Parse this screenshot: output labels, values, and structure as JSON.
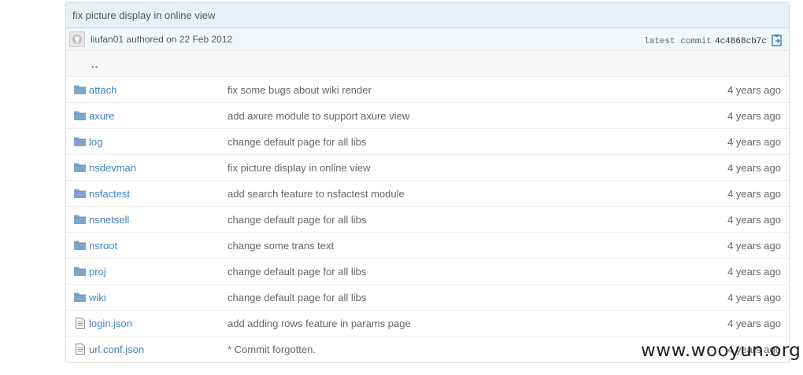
{
  "commit": {
    "title": "fix picture display in online view",
    "author": "liufan01",
    "authored_text": "authored on 22 Feb 2012",
    "latest_label": "latest commit",
    "sha": "4c4868cb7c"
  },
  "up_link": "..",
  "files": [
    {
      "name": "attach",
      "type": "folder",
      "message": "fix some bugs about wiki render",
      "age": "4 years ago"
    },
    {
      "name": "axure",
      "type": "folder",
      "message": "add axure module to support axure view",
      "age": "4 years ago"
    },
    {
      "name": "log",
      "type": "folder",
      "message": "change default page for all libs",
      "age": "4 years ago"
    },
    {
      "name": "nsdevman",
      "type": "folder",
      "message": "fix picture display in online view",
      "age": "4 years ago"
    },
    {
      "name": "nsfactest",
      "type": "folder",
      "message": "add search feature to nsfactest module",
      "age": "4 years ago"
    },
    {
      "name": "nsnetsell",
      "type": "folder",
      "message": "change default page for all libs",
      "age": "4 years ago"
    },
    {
      "name": "nsroot",
      "type": "folder",
      "message": "change some trans text",
      "age": "4 years ago"
    },
    {
      "name": "proj",
      "type": "folder",
      "message": "change default page for all libs",
      "age": "4 years ago"
    },
    {
      "name": "wiki",
      "type": "folder",
      "message": "change default page for all libs",
      "age": "4 years ago"
    },
    {
      "name": "login.json",
      "type": "file",
      "message": "add adding rows feature in params page",
      "age": "4 years ago"
    },
    {
      "name": "url.conf.json",
      "type": "file",
      "message": "* Commit forgotten.",
      "age": "4 years ago"
    }
  ],
  "watermark": "www.wooyun.org",
  "colors": {
    "link": "#4183c4",
    "folder_icon": "#80a6cd",
    "header_bg": "#e6f1f6"
  }
}
